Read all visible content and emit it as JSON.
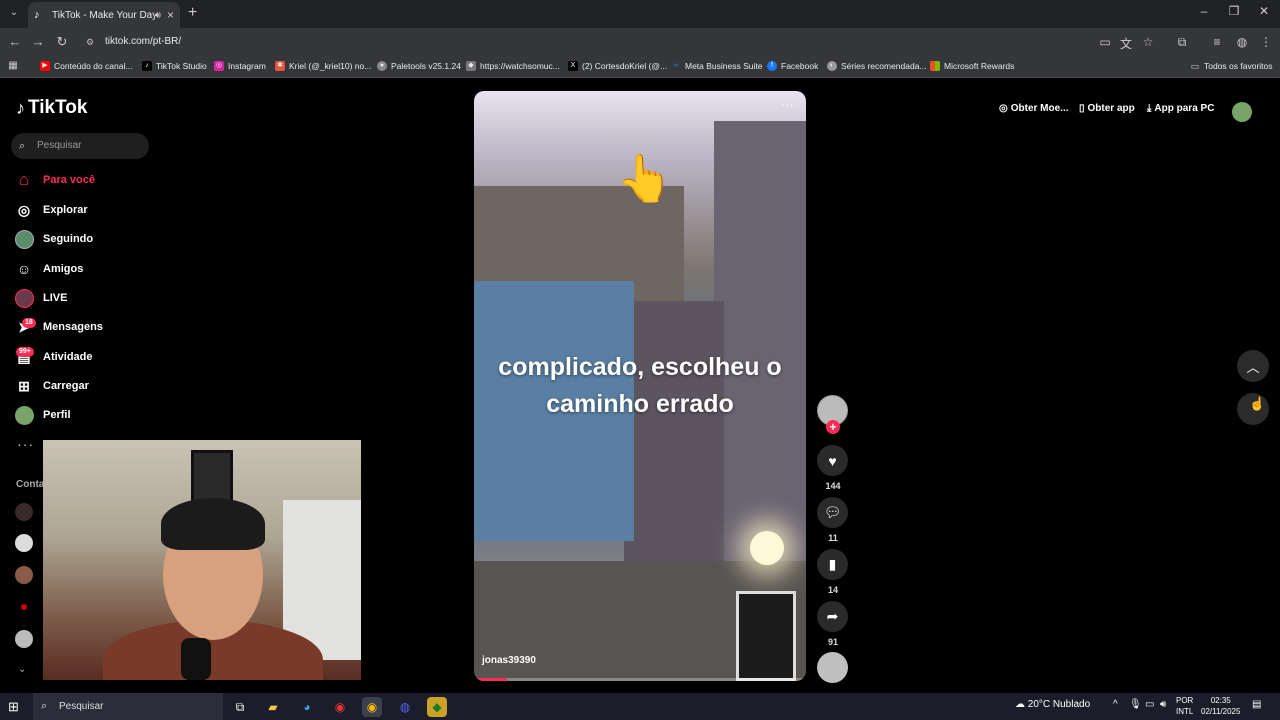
{
  "browser": {
    "tab_title": "TikTok - Make Your Day",
    "url": "tiktok.com/pt-BR/",
    "bookmarks": [
      {
        "label": "Conteúdo do canal...",
        "color": "#ff0000"
      },
      {
        "label": "TikTok Studio",
        "color": "#000000"
      },
      {
        "label": "Instagram",
        "color": "#d6249f"
      },
      {
        "label": "Kriel (@_kriel10) no...",
        "color": "#e2543a"
      },
      {
        "label": "Paletools v25.1.24",
        "color": "#888888"
      },
      {
        "label": "https://watchsomuc...",
        "color": "#777777"
      },
      {
        "label": "(2) CortesdoKriel (@...",
        "color": "#000000"
      },
      {
        "label": "Meta Business Suite",
        "color": "#1877f2"
      },
      {
        "label": "Facebook",
        "color": "#1877f2"
      },
      {
        "label": "Séries recomendada...",
        "color": "#999999"
      },
      {
        "label": "Microsoft Rewards",
        "color": "#f25022"
      }
    ],
    "all_favorites": "Todos os favoritos"
  },
  "tiktok": {
    "logo": "TikTok",
    "search_placeholder": "Pesquisar",
    "nav": [
      {
        "label": "Para você",
        "icon": "home-icon",
        "glyph": "⌂"
      },
      {
        "label": "Explorar",
        "icon": "compass-icon",
        "glyph": "◎"
      },
      {
        "label": "Seguindo",
        "icon": "following-avatar-icon",
        "glyph": "●"
      },
      {
        "label": "Amigos",
        "icon": "friends-icon",
        "glyph": "☺"
      },
      {
        "label": "LIVE",
        "icon": "live-avatar-icon",
        "glyph": "●"
      },
      {
        "label": "Mensagens",
        "icon": "messages-icon",
        "glyph": "➤"
      },
      {
        "label": "Atividade",
        "icon": "activity-icon",
        "glyph": "▤"
      },
      {
        "label": "Carregar",
        "icon": "upload-icon",
        "glyph": "⊞"
      },
      {
        "label": "Perfil",
        "icon": "profile-avatar-icon",
        "glyph": "●"
      }
    ],
    "messages_badge": "18",
    "activity_badge": "99+",
    "more": "···",
    "accounts_heading": "Conta",
    "topbar": {
      "coins": "Obter Moe...",
      "get_app": "Obter app",
      "pc_app": "App para PC"
    },
    "video": {
      "caption": "complicado, escolheu o caminho errado",
      "author": "jonas39390",
      "progress": 0.1,
      "likes": "144",
      "comments": "11",
      "saves": "14",
      "shares": "91"
    },
    "accent": "#fe2c55"
  },
  "taskbar": {
    "search": "Pesquisar",
    "weather": "20°C  Nublado",
    "lang_top": "POR",
    "lang_bottom": "INTL",
    "time": "02:35",
    "date": "02/11/2025"
  }
}
